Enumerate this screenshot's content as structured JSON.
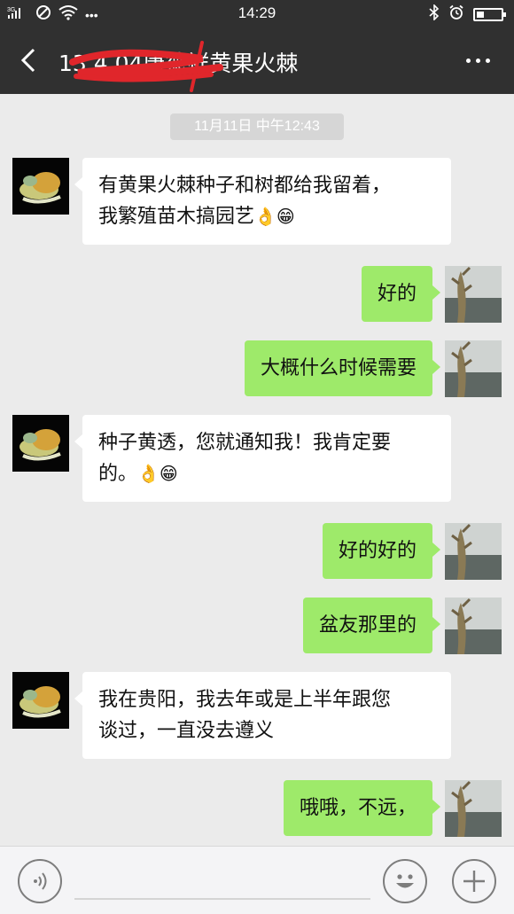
{
  "status_bar": {
    "network": "3G",
    "time": "14:29",
    "more_dots": "•••"
  },
  "header": {
    "title": "13    4       04唐德祥黄果火棘"
  },
  "timestamp": "11月11日 中午12:43",
  "messages": [
    {
      "from": "other",
      "lines": [
        "有黄果火棘种子和树都给我留着，",
        "我繁殖苗木搞园艺"
      ],
      "emoji": "👌😁"
    },
    {
      "from": "self",
      "lines": [
        "好的"
      ]
    },
    {
      "from": "self",
      "lines": [
        "大概什么时候需要"
      ]
    },
    {
      "from": "other",
      "lines": [
        "种子黄透，您就通知我！我肯定要",
        "的。"
      ],
      "emoji": "👌😁"
    },
    {
      "from": "self",
      "lines": [
        "好的好的"
      ]
    },
    {
      "from": "self",
      "lines": [
        "盆友那里的"
      ]
    },
    {
      "from": "other",
      "lines": [
        "我在贵阳，我去年或是上半年跟您",
        "谈过，一直没去遵义"
      ]
    },
    {
      "from": "self",
      "lines": [
        "哦哦，不远，"
      ]
    }
  ],
  "colors": {
    "header_bg": "#303030",
    "chat_bg": "#ebebeb",
    "outgoing_bubble": "#9eea6a",
    "incoming_bubble": "#ffffff"
  },
  "icons": {
    "back": "chevron-left-icon",
    "more": "more-dots-icon",
    "voice": "voice-icon",
    "emoji": "emoji-face-icon",
    "plus": "plus-icon"
  }
}
